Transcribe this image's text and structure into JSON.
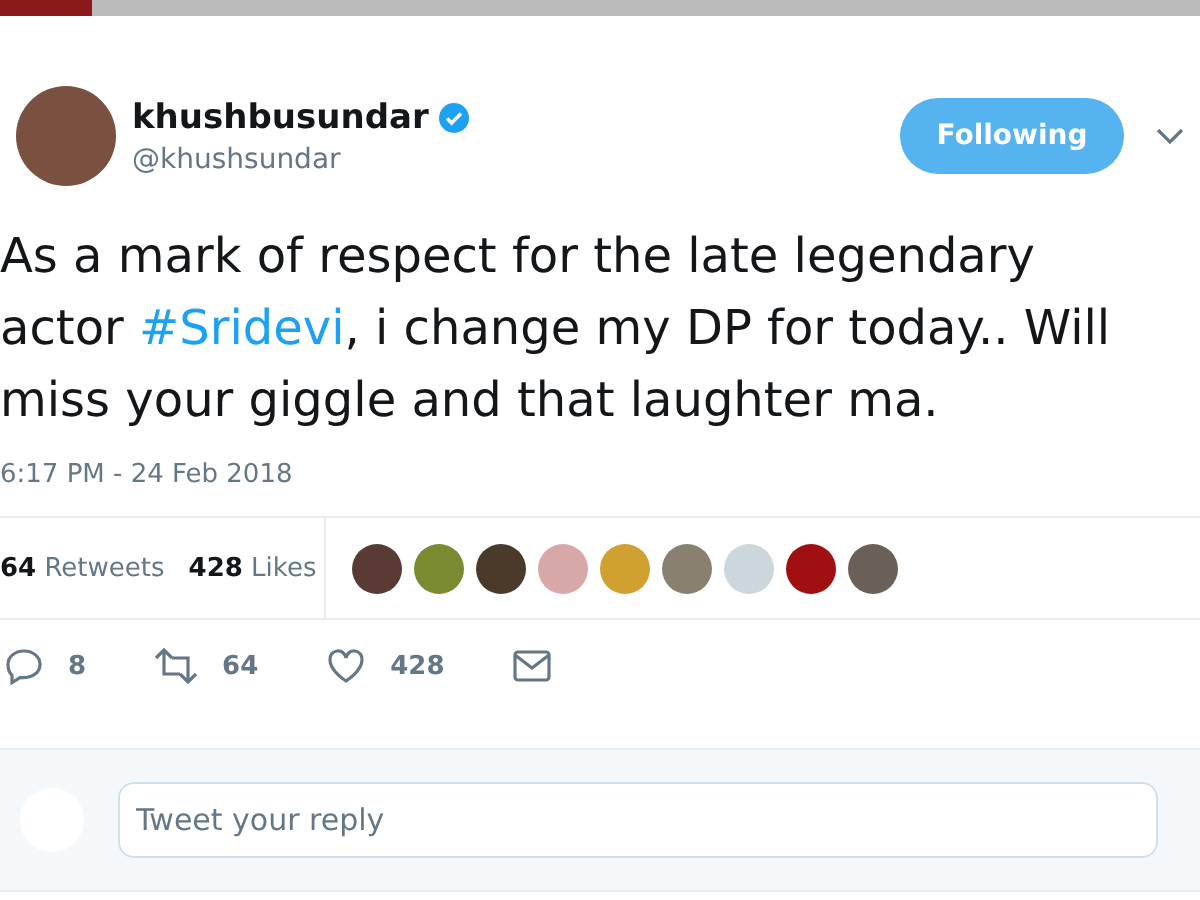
{
  "author": {
    "name": "khushbusundar",
    "verified": true,
    "handle": "@khushsundar"
  },
  "follow_button": {
    "label": "Following"
  },
  "tweet_text": [
    {
      "kind": "plain",
      "text": "As a mark of respect for the late legendary actor "
    },
    {
      "kind": "hashtag",
      "text": "#Sridevi"
    },
    {
      "kind": "plain",
      "text": ", i change my DP for today.. Will miss your giggle and that laughter ma."
    }
  ],
  "timestamp": "6:17 PM - 24 Feb 2018",
  "stats": [
    {
      "count": "64",
      "label": "Retweets"
    },
    {
      "count": "428",
      "label": "Likes"
    }
  ],
  "likers": [
    {
      "color": "#5a3a35"
    },
    {
      "color": "#7a8a30"
    },
    {
      "color": "#4a3a2a"
    },
    {
      "color": "#d8a8a8"
    },
    {
      "color": "#d0a030"
    },
    {
      "color": "#8a8070"
    },
    {
      "color": "#ccd6dd"
    },
    {
      "color": "#a01010"
    },
    {
      "color": "#6a6058"
    }
  ],
  "actions": [
    {
      "kind": "reply",
      "count": "8"
    },
    {
      "kind": "retweet",
      "count": "64"
    },
    {
      "kind": "like",
      "count": "428"
    },
    {
      "kind": "message"
    }
  ],
  "reply_box": {
    "placeholder": "Tweet your reply"
  }
}
